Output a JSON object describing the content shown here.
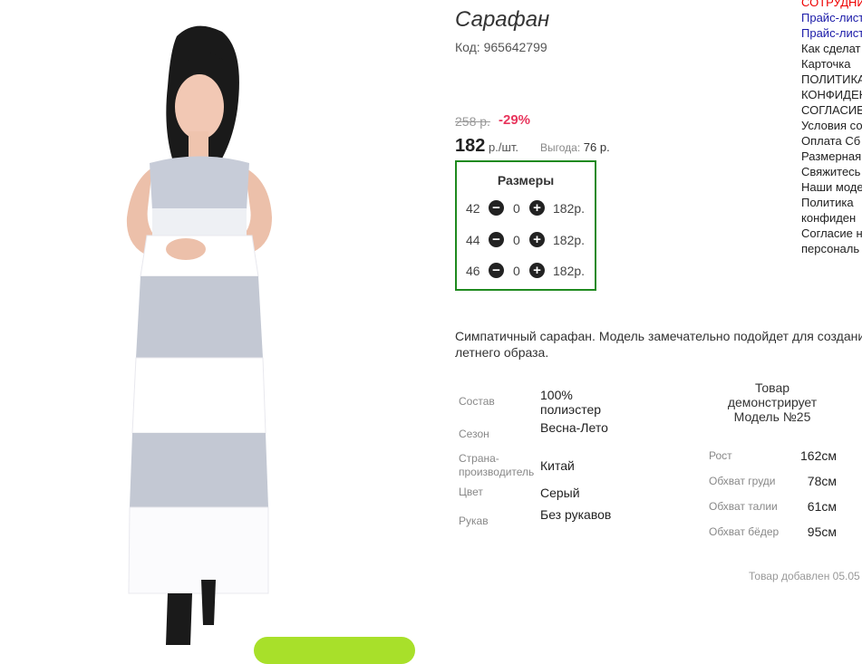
{
  "product": {
    "title": "Сарафан",
    "code": "Код: 965642799",
    "old_price": "258 р.",
    "discount": "-29%",
    "price": "182",
    "price_unit": " р./шт.",
    "benefit_label": "Выгода:",
    "benefit_value": " 76 р."
  },
  "sizes": {
    "heading": "Размеры",
    "rows": [
      {
        "size": "42",
        "qty": "0",
        "price": "182р."
      },
      {
        "size": "44",
        "qty": "0",
        "price": "182р."
      },
      {
        "size": "46",
        "qty": "0",
        "price": "182р."
      }
    ]
  },
  "description": "Симпатичный сарафан. Модель замечательно подойдет для создания летнего образа.",
  "properties": [
    {
      "label": "Состав",
      "value": "100% полиэстер"
    },
    {
      "label": "Сезон",
      "value": "Весна-Лето"
    },
    {
      "label": "Страна-производитель",
      "value": "Китай"
    },
    {
      "label": "Цвет",
      "value": "Серый"
    },
    {
      "label": "Рукав",
      "value": "Без рукавов"
    }
  ],
  "model": {
    "heading": "Товар демонстрирует Модель №25",
    "params": [
      {
        "label": "Рост",
        "value": "162см"
      },
      {
        "label": "Обхват груди",
        "value": "78см"
      },
      {
        "label": "Обхват талии",
        "value": "61см"
      },
      {
        "label": "Обхват бёдер",
        "value": "95см"
      }
    ]
  },
  "added": "Товар добавлен 05.05",
  "right_links": [
    "СОТРУДНИ",
    "Прайс-лист",
    "Прайс-лист",
    "Как сделат",
    "Карточка",
    "ПОЛИТИКА",
    "КОНФИДЕН",
    "СОГЛАСИЕ",
    "Условия со",
    "Оплата Сб",
    "Размерная",
    "Свяжитесь",
    "Наши моде",
    "Политика",
    "конфиден",
    "Согласие н",
    "персональ"
  ],
  "colors": {
    "discount": "#e8365d",
    "sizes_border": "#1f8a1f",
    "cart_button": "#a8e02a",
    "link_blue": "#1a1aa8",
    "link_red": "#ee0000"
  },
  "icons": [
    "minus-icon",
    "plus-icon"
  ]
}
